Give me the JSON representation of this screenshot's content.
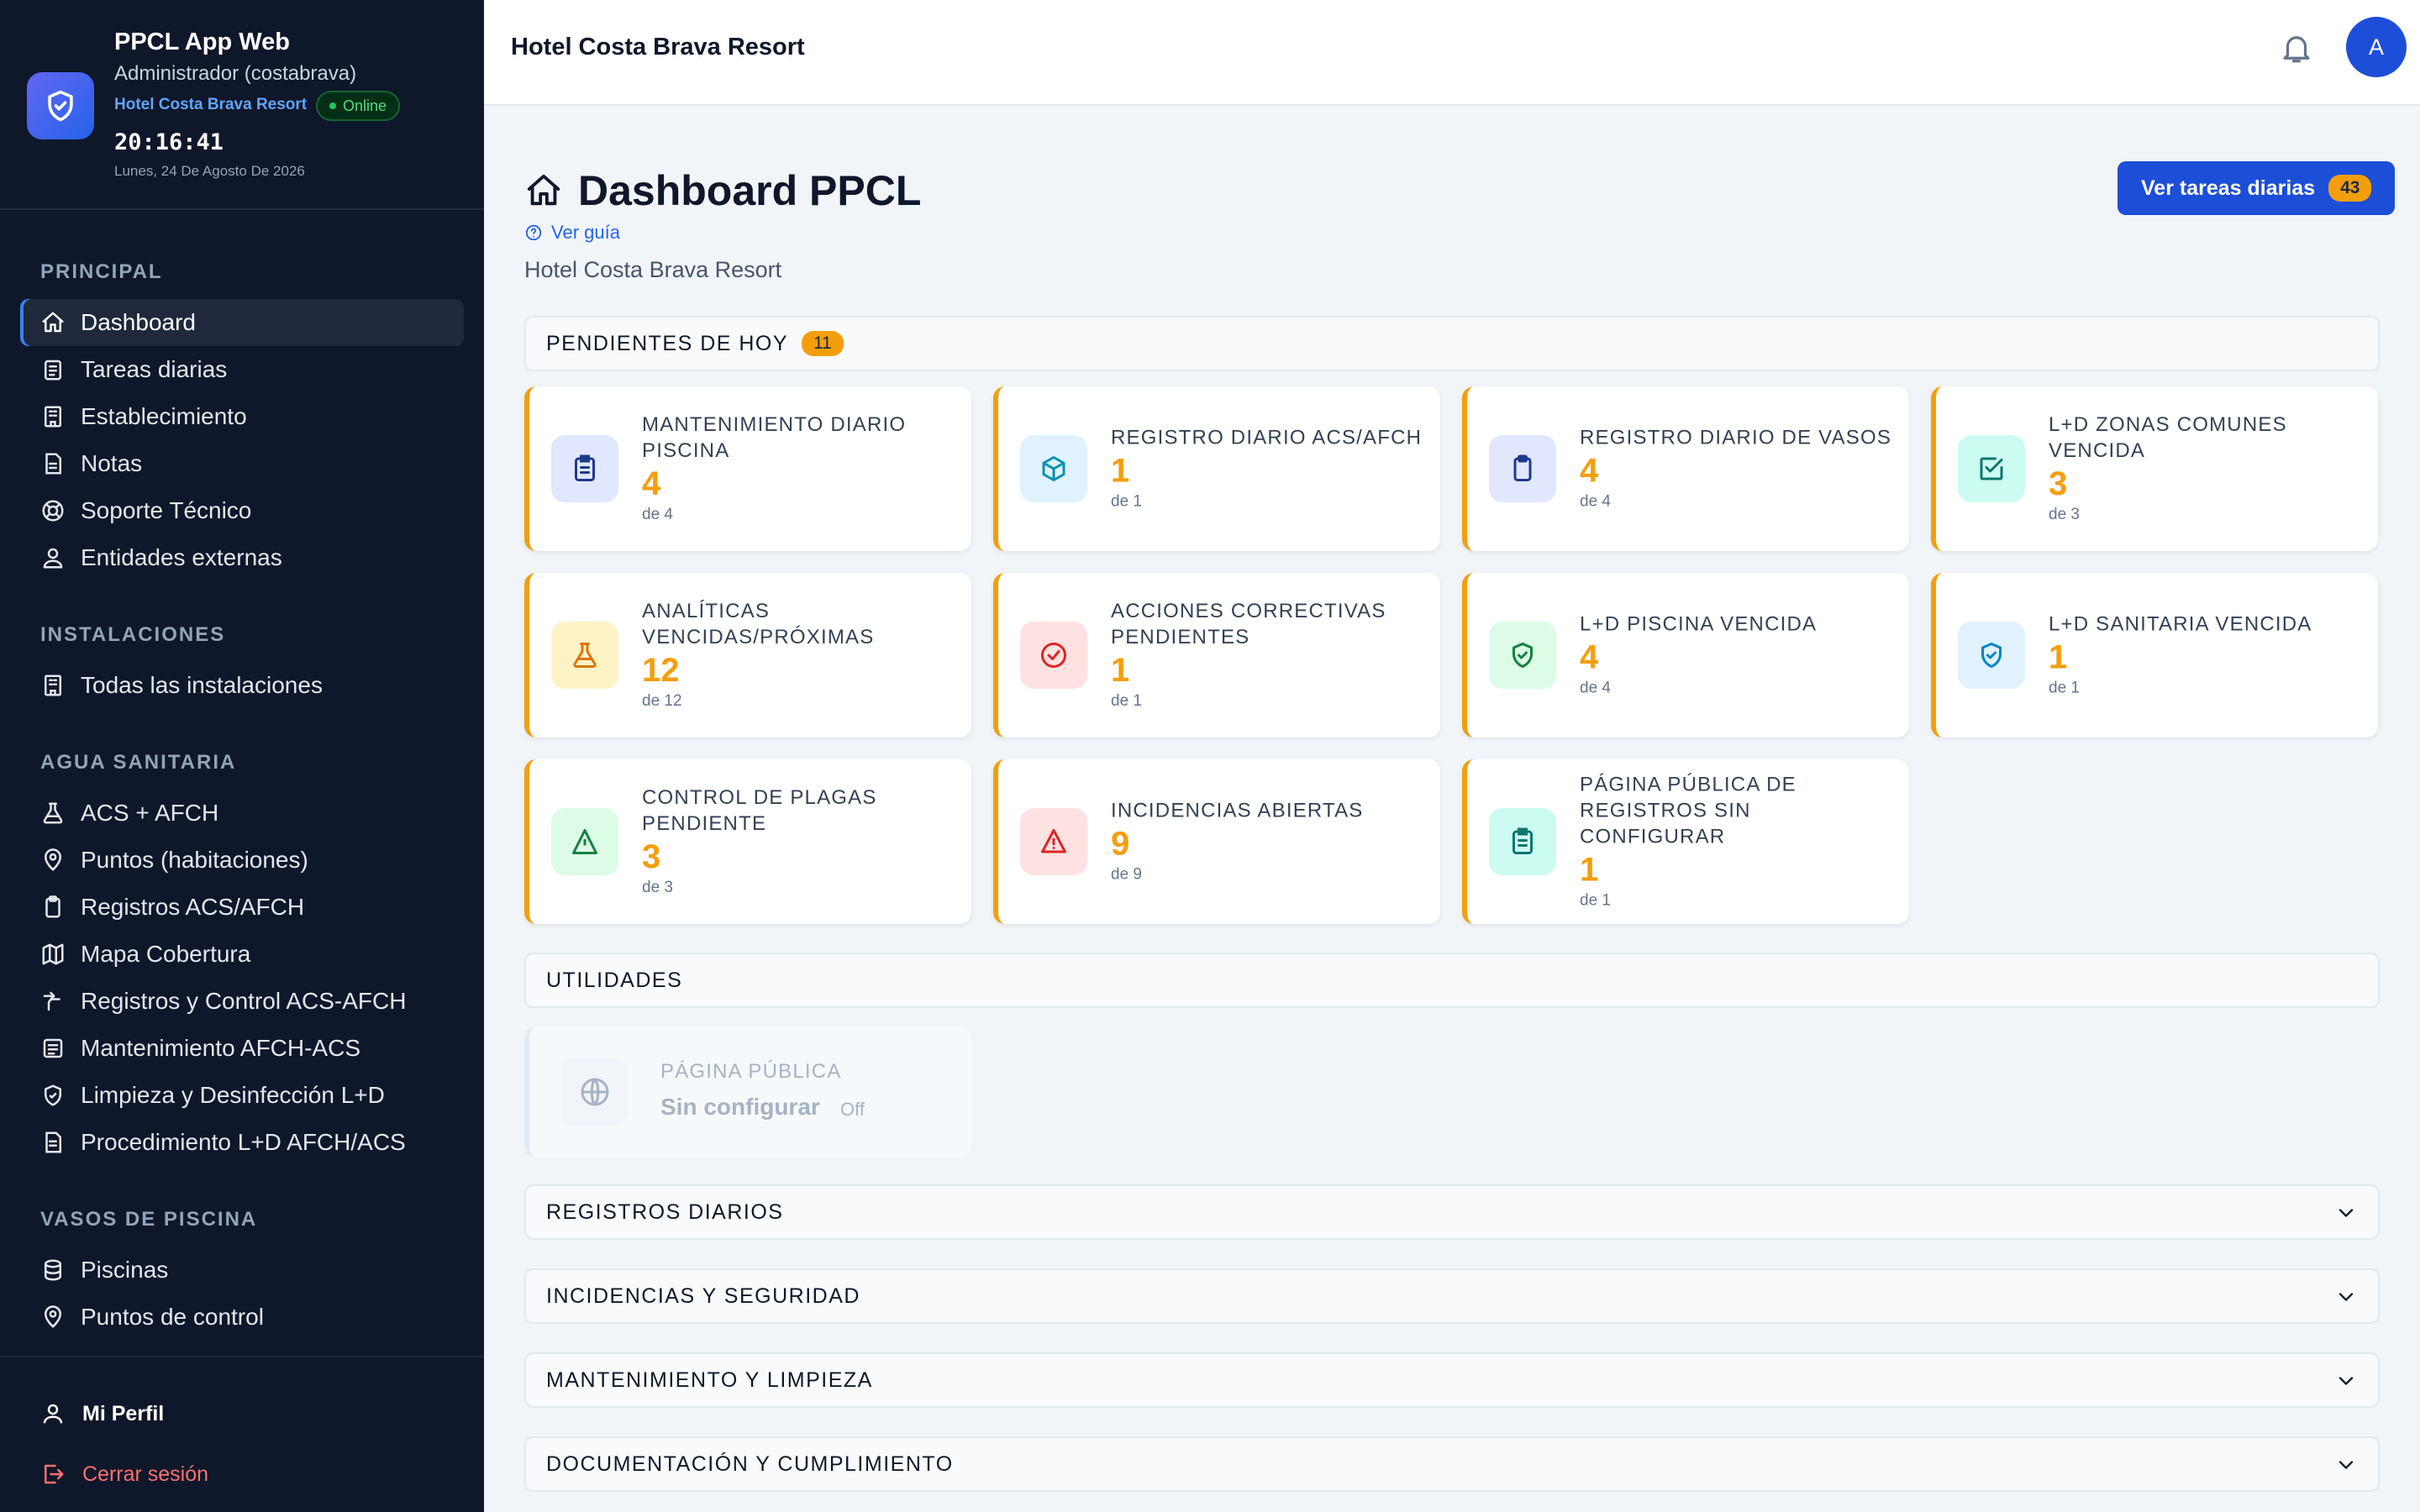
{
  "app": {
    "title": "PPCL App Web",
    "role": "Administrador (costabrava)",
    "hotel": "Hotel Costa Brava Resort",
    "status": "Online",
    "clock": "20:16:41",
    "date": "Lunes, 24 De Agosto De 2026"
  },
  "colors": {
    "sidebar_bg": "#0f172a",
    "accent": "#1d4ed8",
    "warning": "#f59e0b",
    "online": "#22c55e",
    "danger": "#f87171"
  },
  "sidebar": {
    "sections": [
      {
        "title": "PRINCIPAL",
        "items": [
          {
            "label": "Dashboard",
            "icon": "home-icon",
            "active": true
          },
          {
            "label": "Tareas diarias",
            "icon": "clipboard-list-icon"
          },
          {
            "label": "Establecimiento",
            "icon": "building-icon"
          },
          {
            "label": "Notas",
            "icon": "note-icon"
          },
          {
            "label": "Soporte Técnico",
            "icon": "lifebuoy-icon"
          },
          {
            "label": "Entidades externas",
            "icon": "users-icon"
          }
        ]
      },
      {
        "title": "INSTALACIONES",
        "items": [
          {
            "label": "Todas las instalaciones",
            "icon": "building-icon"
          }
        ]
      },
      {
        "title": "AGUA SANITARIA",
        "items": [
          {
            "label": "ACS + AFCH",
            "icon": "flask-icon"
          },
          {
            "label": "Puntos (habitaciones)",
            "icon": "map-pin-icon"
          },
          {
            "label": "Registros ACS/AFCH",
            "icon": "clipboard-icon"
          },
          {
            "label": "Mapa Cobertura",
            "icon": "map-icon"
          },
          {
            "label": "Registros y Control ACS-AFCH",
            "icon": "route-icon"
          },
          {
            "label": "Mantenimiento AFCH-ACS",
            "icon": "clipboard-list-icon"
          },
          {
            "label": "Limpieza y Desinfección L+D",
            "icon": "shield-icon"
          },
          {
            "label": "Procedimiento L+D AFCH/ACS",
            "icon": "file-text-icon"
          }
        ]
      },
      {
        "title": "VASOS DE PISCINA",
        "items": [
          {
            "label": "Piscinas",
            "icon": "database-icon"
          },
          {
            "label": "Puntos de control",
            "icon": "map-pin-icon"
          }
        ]
      }
    ],
    "footer": {
      "profile": "Mi Perfil",
      "logout": "Cerrar sesión"
    }
  },
  "header": {
    "title": "Hotel Costa Brava Resort",
    "avatar_initial": "A"
  },
  "main": {
    "title": "Dashboard PPCL",
    "guide": "Ver guía",
    "subtitle": "Hotel Costa Brava Resort",
    "tasks_button": {
      "label": "Ver tareas diarias",
      "count": "43"
    },
    "pending": {
      "title": "PENDIENTES DE HOY",
      "count": "11",
      "cards": [
        {
          "title": "Mantenimiento diario piscina",
          "count": "4",
          "sub": "de 4",
          "icon": "clipboard-list-icon",
          "tone": "#1e3a8a",
          "bg": "#e0e7ff"
        },
        {
          "title": "Registro diario ACS/AFCH",
          "count": "1",
          "sub": "de 1",
          "icon": "cube-icon",
          "tone": "#0891b2",
          "bg": "#e0f2fe"
        },
        {
          "title": "Registro diario de vasos",
          "count": "4",
          "sub": "de 4",
          "icon": "clipboard-icon",
          "tone": "#1e3a8a",
          "bg": "#e0e7ff"
        },
        {
          "title": "L+D Zonas comunes vencida",
          "count": "3",
          "sub": "de 3",
          "icon": "check-square-icon",
          "tone": "#0f766e",
          "bg": "#ccfbf1"
        },
        {
          "title": "Analíticas vencidas/próximas",
          "count": "12",
          "sub": "de 12",
          "icon": "flask-icon",
          "tone": "#d97706",
          "bg": "#fef3c7"
        },
        {
          "title": "Acciones correctivas pendientes",
          "count": "1",
          "sub": "de 1",
          "icon": "check-circle-icon",
          "tone": "#dc2626",
          "bg": "#fee2e2"
        },
        {
          "title": "L+D Piscina vencida",
          "count": "4",
          "sub": "de 4",
          "icon": "shield-check-icon",
          "tone": "#15803d",
          "bg": "#dcfce7"
        },
        {
          "title": "L+D Sanitaria vencida",
          "count": "1",
          "sub": "de 1",
          "icon": "shield-check-icon",
          "tone": "#0284c7",
          "bg": "#e0f2fe"
        },
        {
          "title": "Control de plagas pendiente",
          "count": "3",
          "sub": "de 3",
          "icon": "triangle-icon",
          "tone": "#15803d",
          "bg": "#dcfce7"
        },
        {
          "title": "Incidencias abiertas",
          "count": "9",
          "sub": "de 9",
          "icon": "alert-triangle-icon",
          "tone": "#dc2626",
          "bg": "#fee2e2"
        },
        {
          "title": "Página pública de registros sin configurar",
          "count": "1",
          "sub": "de 1",
          "icon": "clipboard-list-icon",
          "tone": "#0f766e",
          "bg": "#ccfbf1"
        }
      ]
    },
    "utilities": {
      "title": "UTILIDADES",
      "card": {
        "label": "PÁGINA PÚBLICA",
        "status": "Sin configurar",
        "state": "Off"
      }
    },
    "accordions": [
      {
        "title": "REGISTROS DIARIOS"
      },
      {
        "title": "INCIDENCIAS Y SEGURIDAD"
      },
      {
        "title": "MANTENIMIENTO Y LIMPIEZA"
      },
      {
        "title": "DOCUMENTACIÓN Y CUMPLIMIENTO"
      }
    ]
  }
}
